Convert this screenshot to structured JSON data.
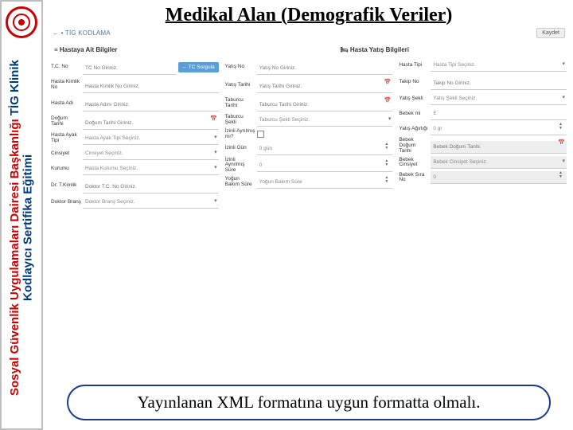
{
  "sidebar": {
    "line1": "Sosyal Güvenlik Uygulamaları Dairesi Başkanlığı",
    "line2": "TİG Klinik Kodlayıcı Sertifika Eğitimi"
  },
  "title": {
    "underlined": "Medikal Alan (Demografik Veriler",
    "rest": ")"
  },
  "toolbar": {
    "brand": "← • TİG KODLAMA",
    "save": "Kaydet"
  },
  "sections": {
    "patient": "≡ Hastaya Ait Bilgiler",
    "visit": "🛏 Hasta Yatış Bilgileri"
  },
  "col1": {
    "tcno": {
      "label": "T.C. No",
      "placeholder": "TC No Giriniz.",
      "btn": "← TC Sorgula"
    },
    "hkimlik": {
      "label": "Hasta Kimlik No",
      "placeholder": "Hasta Kimlik No Giriniz."
    },
    "hadi": {
      "label": "Hasta Adı",
      "placeholder": "Hasta Adını Giriniz."
    },
    "dt": {
      "label": "Doğum Tarihi",
      "placeholder": "Doğum Tarihi Giriniz."
    },
    "ayak": {
      "label": "Hasta Ayak Tipi",
      "placeholder": "Hasta Ayak Tipi Seçiniz."
    },
    "cins": {
      "label": "Cinsiyet",
      "placeholder": "Cinsiyet Seçiniz."
    },
    "kurum": {
      "label": "Kurumu",
      "placeholder": "Hasta Kurumu Seçiniz."
    },
    "drtc": {
      "label": "Dr. T.Kimlik",
      "placeholder": "Doktor T.C. No Giriniz."
    },
    "drbrans": {
      "label": "Doktor Branş",
      "placeholder": "Doktor Branş Seçiniz."
    }
  },
  "col2": {
    "yatisno": {
      "label": "Yatış No",
      "placeholder": "Yatış No Giriniz."
    },
    "yatist": {
      "label": "Yatış Tarihi",
      "placeholder": "Yatış Tarihi Giriniz."
    },
    "tabt": {
      "label": "Taburcu Tarihi",
      "placeholder": "Taburcu Tarihi Giriniz."
    },
    "tabs": {
      "label": "Taburcu Şekli",
      "placeholder": "Taburcu Şekli Seçiniz."
    },
    "ayr": {
      "label": "İzinli Ayrılmış mı?",
      "value": ""
    },
    "izin": {
      "label": "İzinli Gün",
      "value": "0 gün"
    },
    "aynilmis": {
      "label": "İzinli Aynılmış Süre",
      "value": "0"
    },
    "ybs": {
      "label": "Yoğun Bakım Süre",
      "value": "Yoğun Bakım Süre"
    }
  },
  "col3": {
    "htipi": {
      "label": "Hasta Tipi",
      "placeholder": "Hasta Tipi Seçiniz."
    },
    "takipno": {
      "label": "Takip No",
      "placeholder": "Takip No Giriniz."
    },
    "ysekli": {
      "label": "Yatış Şekli",
      "placeholder": "Yatış Şekli Seçiniz."
    },
    "bebek": {
      "label": "Bebek mi",
      "value": "E"
    },
    "yagir": {
      "label": "Yatış Ağırlığı",
      "value": "0 gr"
    },
    "bdt": {
      "label": "Bebek Doğum Tarihi",
      "placeholder": "Bebek Doğum Tarihi."
    },
    "bcins": {
      "label": "Bebek Cinsiyet",
      "placeholder": "Bebek Cinsiyet Seçiniz."
    },
    "bsira": {
      "label": "Bebek Sıra No",
      "value": "0"
    }
  },
  "footer": {
    "text": "Yayınlanan XML formatına uygun formatta olmalı."
  }
}
